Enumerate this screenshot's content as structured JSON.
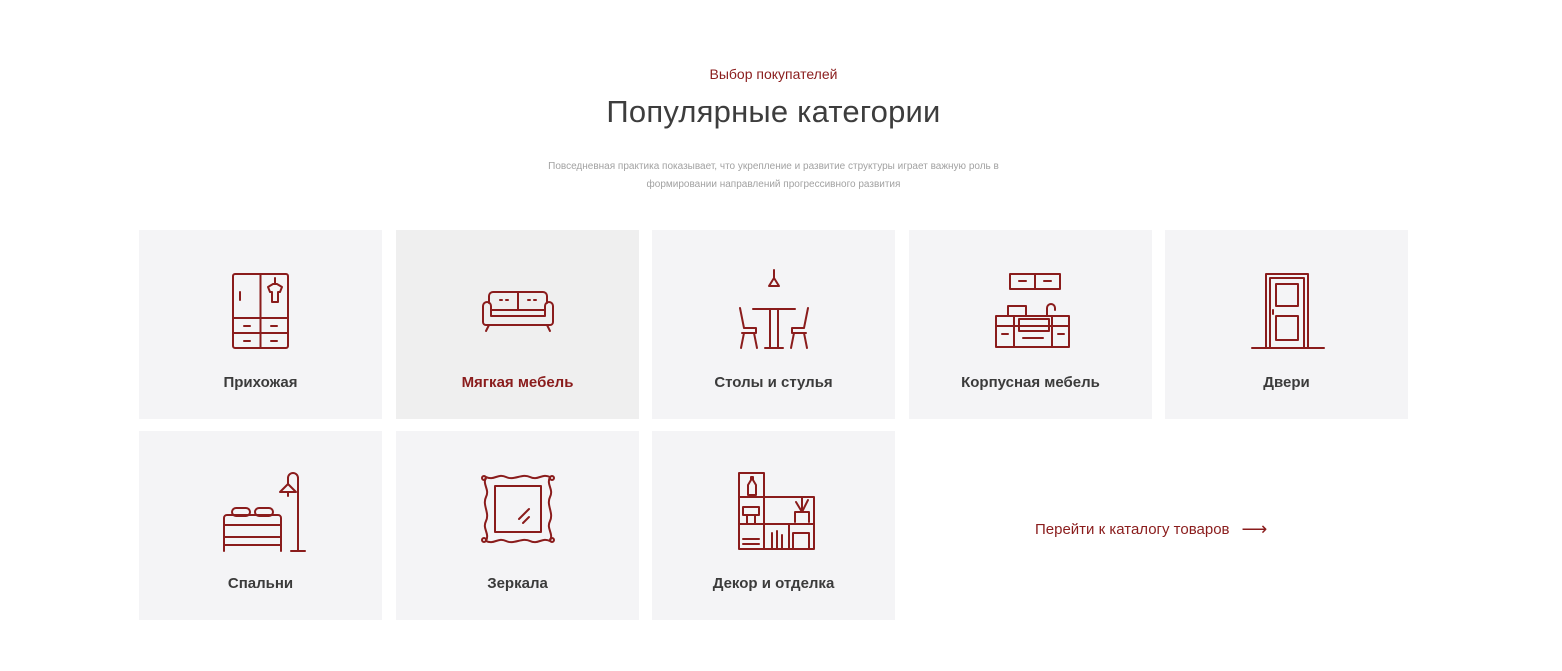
{
  "section": {
    "eyebrow": "Выбор покупателей",
    "title": "Популярные категории",
    "description": "Повседневная практика показывает, что укрепление и развитие структуры играет важную роль в формировании направлений прогрессивного развития"
  },
  "categories": [
    {
      "label": "Прихожая",
      "icon": "wardrobe-icon"
    },
    {
      "label": "Мягкая мебель",
      "icon": "sofa-icon",
      "active": true
    },
    {
      "label": "Столы и стулья",
      "icon": "table-chairs-icon"
    },
    {
      "label": "Корпусная мебель",
      "icon": "kitchen-cabinets-icon"
    },
    {
      "label": "Двери",
      "icon": "door-icon"
    },
    {
      "label": "Спальни",
      "icon": "bed-icon"
    },
    {
      "label": "Зеркала",
      "icon": "mirror-icon"
    },
    {
      "label": "Декор и отделка",
      "icon": "shelf-decor-icon"
    }
  ],
  "catalog_link": {
    "label": "Перейти к каталогу товаров",
    "arrow": "⟶"
  },
  "colors": {
    "accent": "#8a1c1c",
    "card_bg": "#f4f4f6",
    "text": "#3b3b3b",
    "muted": "#a2a2a2"
  }
}
